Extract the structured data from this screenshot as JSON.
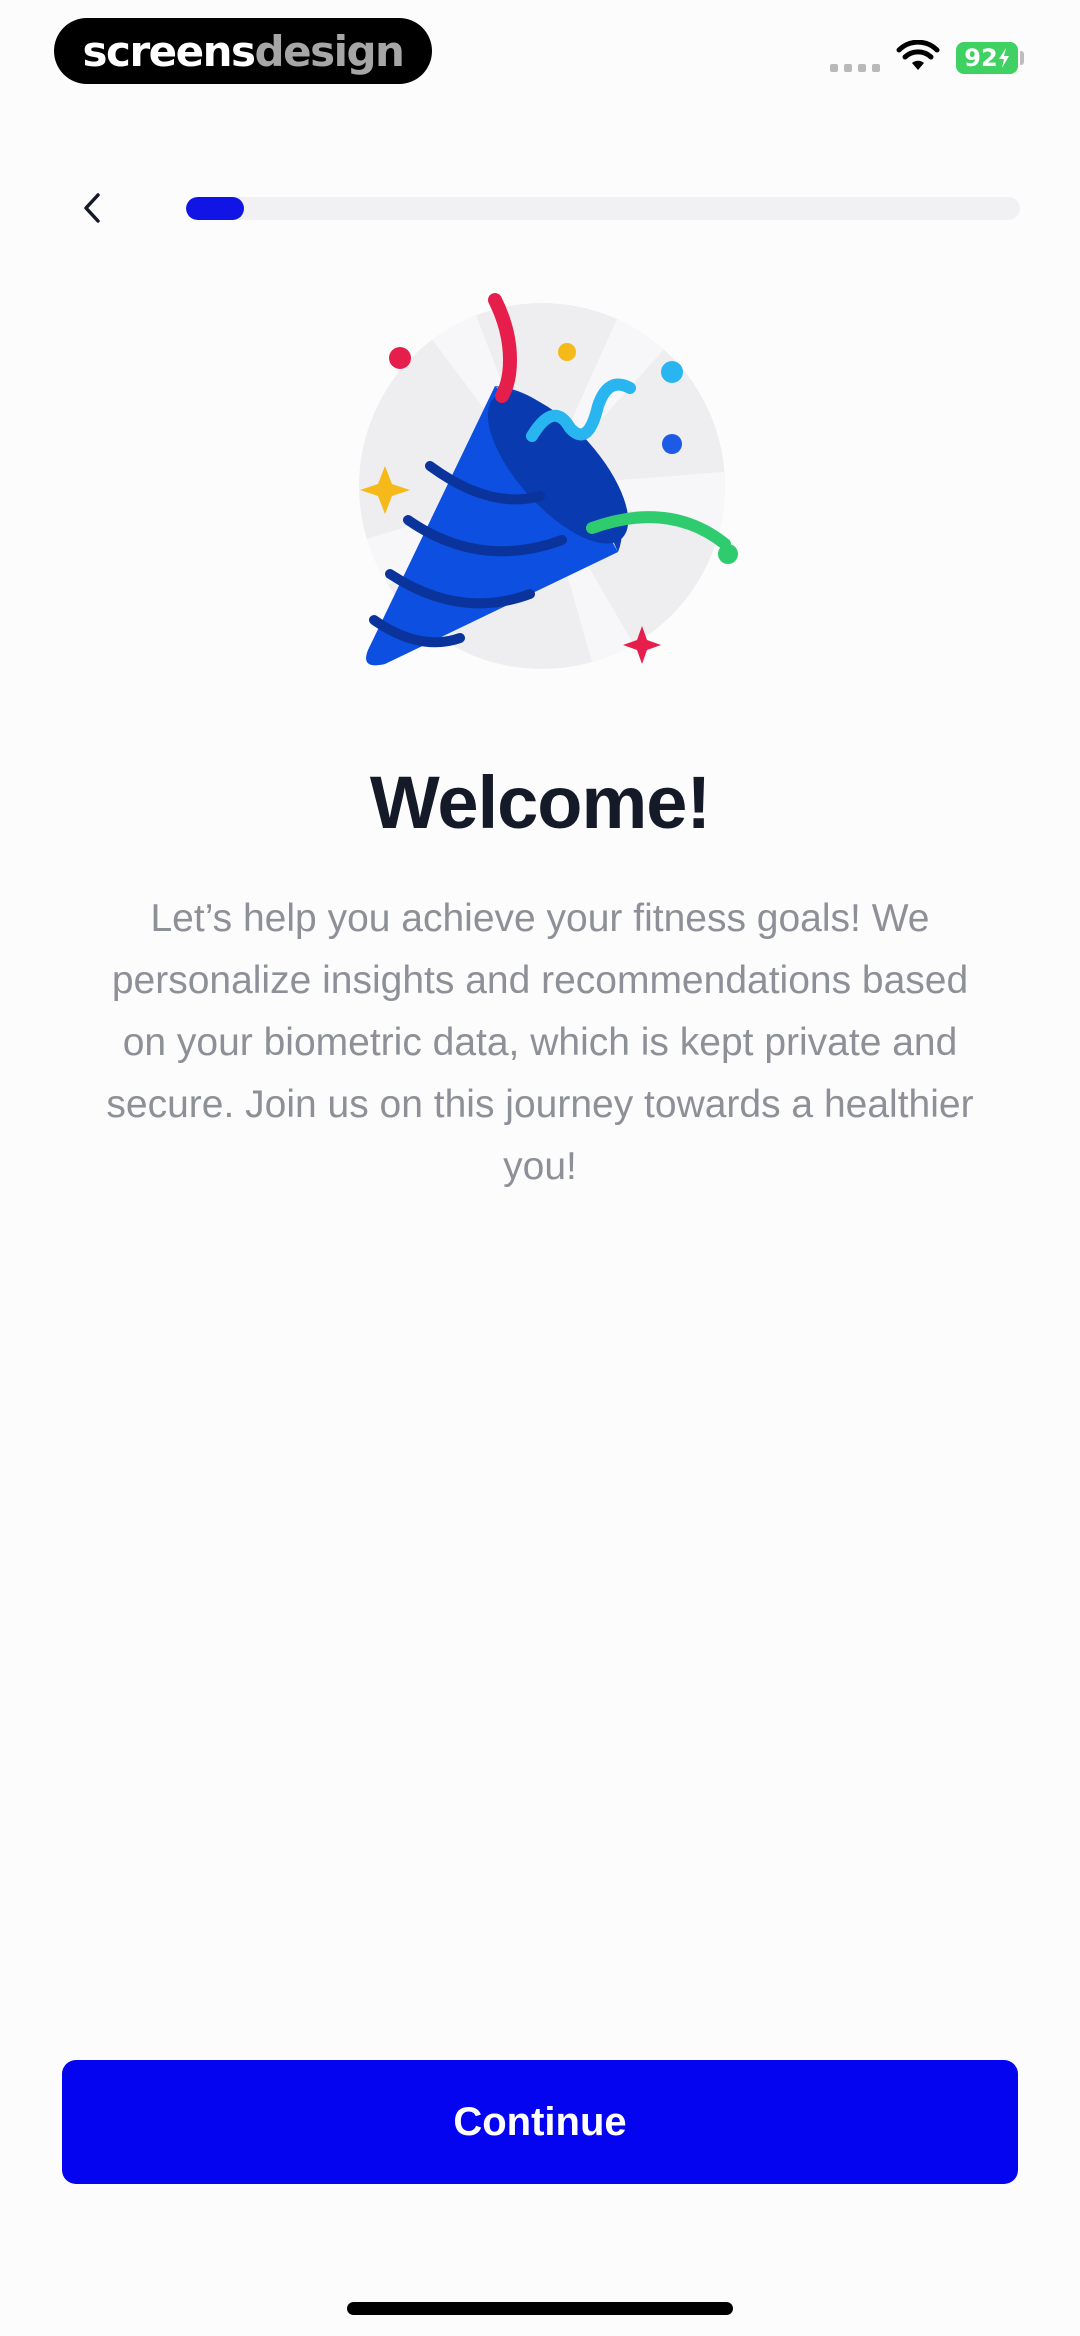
{
  "status_bar": {
    "brand_part1": "screens",
    "brand_part2": "design",
    "battery_level": "92",
    "battery_charging": true,
    "battery_color": "#3fd161"
  },
  "nav": {
    "back_icon": "chevron-left-icon",
    "progress_fraction": 0.07,
    "progress_color": "#1015e6"
  },
  "illustration": {
    "icon": "party-popper-icon"
  },
  "content": {
    "title": "Welcome!",
    "body": "Let’s help you achieve your fitness goals! We personalize insights and recommendations based on your biometric data, which is kept private and secure. Join us on this journey towards a healthier you!"
  },
  "footer": {
    "continue_label": "Continue",
    "accent_color": "#0404f0"
  }
}
